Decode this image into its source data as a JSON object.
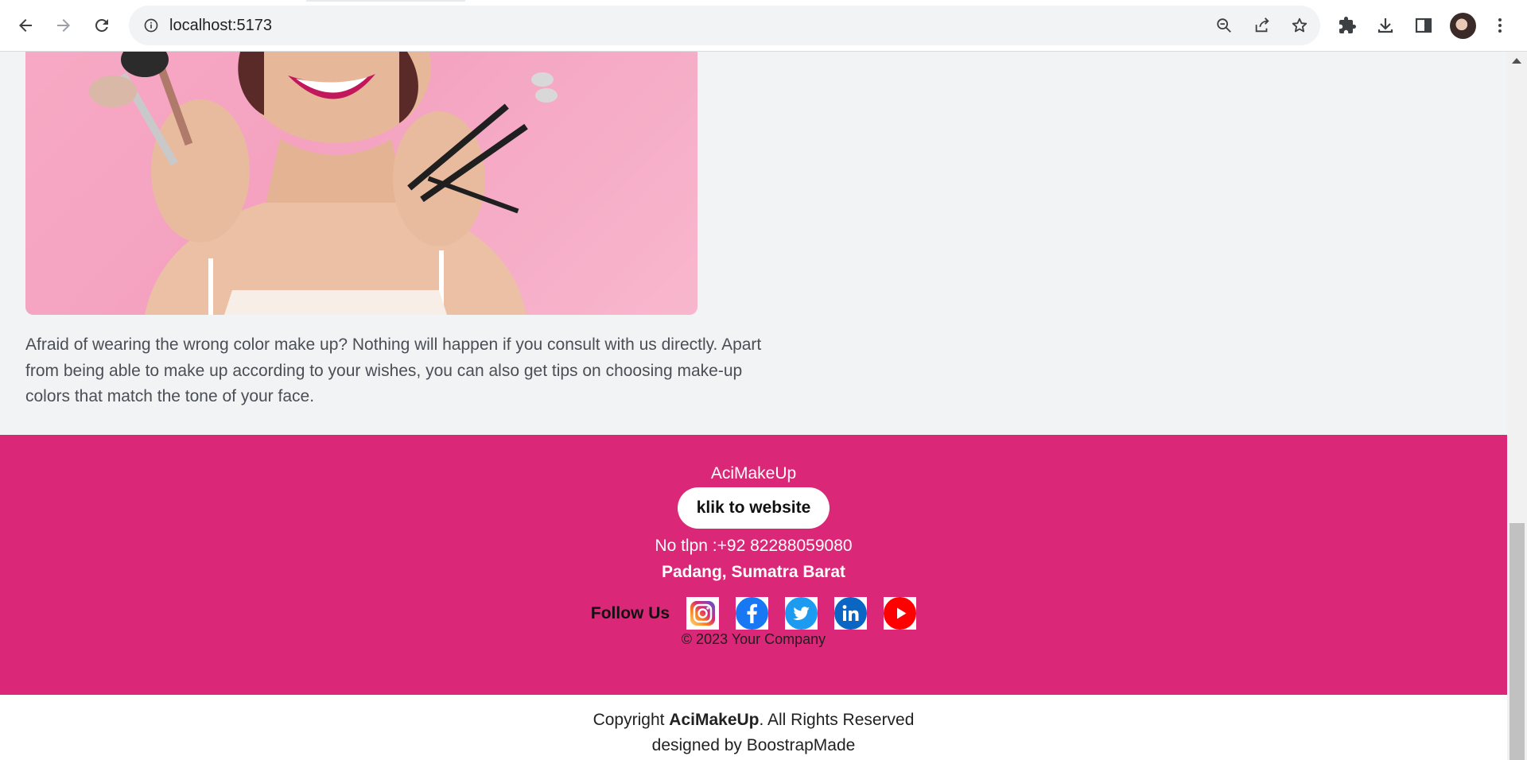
{
  "browser": {
    "url": "localhost:5173"
  },
  "content": {
    "description": "Afraid of wearing the wrong color make up? Nothing will happen if you consult with us directly. Apart from being able to make up according to your wishes, you can also get tips on choosing make-up colors that match the tone of your face."
  },
  "footer": {
    "brand": "AciMakeUp",
    "button_label": "klik to website",
    "phone": "No tlpn :+92 82288059080",
    "address": "Padang, Sumatra Barat",
    "follow_label": "Follow Us",
    "social_icons": [
      "instagram-icon",
      "facebook-icon",
      "twitter-icon",
      "linkedin-icon",
      "youtube-icon"
    ],
    "copyright_small": "© 2023 Your Company"
  },
  "bottom_bar": {
    "copyright_prefix": "Copyright ",
    "copyright_brand": "AciMakeUp",
    "copyright_suffix": ". All Rights Reserved",
    "designed_by": "designed by BoostrapMade"
  },
  "colors": {
    "footer_bg": "#db2777",
    "page_bg": "#f2f3f5"
  }
}
